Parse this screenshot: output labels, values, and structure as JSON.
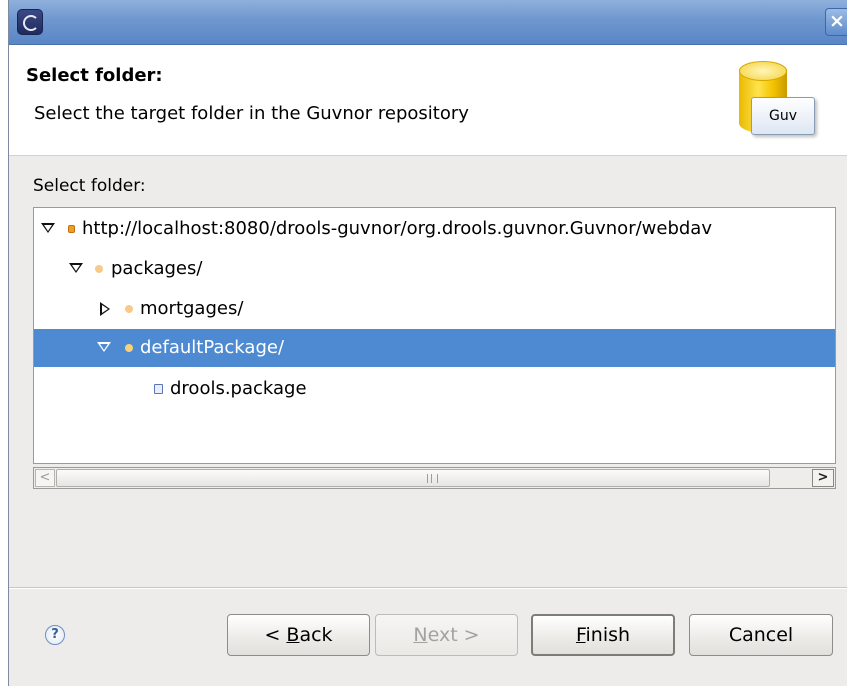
{
  "window": {
    "close_glyph": "×"
  },
  "header": {
    "title": "Select folder:",
    "description": "Select the target folder in the Guvnor repository",
    "badge_text": "Guv"
  },
  "body": {
    "select_label": "Select folder:",
    "tree": [
      {
        "label": "http://localhost:8080/drools-guvnor/org.drools.guvnor.Guvnor/webdav",
        "state": "expanded",
        "icon": "server-icon",
        "selected": false
      },
      {
        "label": "packages/",
        "state": "expanded",
        "icon": "folder-icon",
        "selected": false
      },
      {
        "label": "mortgages/",
        "state": "collapsed",
        "icon": "folder-icon",
        "selected": false
      },
      {
        "label": "defaultPackage/",
        "state": "expanded",
        "icon": "folder-icon",
        "selected": true
      },
      {
        "label": "drools.package",
        "state": "leaf",
        "icon": "file-icon",
        "selected": false
      }
    ],
    "scroll_left_glyph": "<",
    "scroll_right_glyph": ">"
  },
  "footer": {
    "help_glyph": "?",
    "back_prefix": "< ",
    "back_mnemonic": "B",
    "back_rest": "ack",
    "next_mnemonic": "N",
    "next_rest": "ext >",
    "finish_mnemonic": "F",
    "finish_rest": "inish",
    "cancel_label": "Cancel"
  },
  "colors": {
    "selection": "#4d8ad2",
    "titlebar": "#6f97cf",
    "dialog_bg": "#edeceb"
  }
}
